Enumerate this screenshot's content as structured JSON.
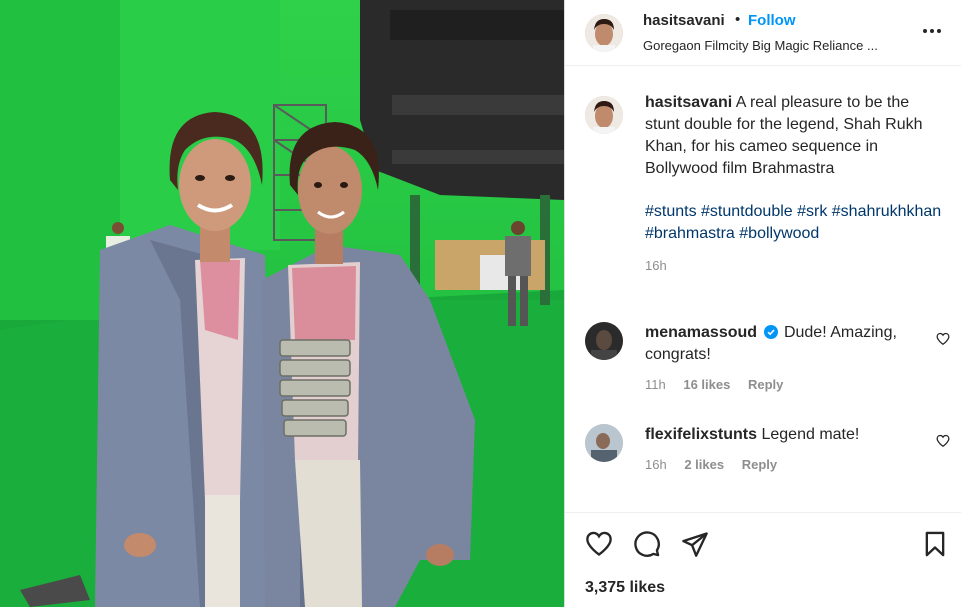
{
  "post": {
    "username": "hasitsavani",
    "dot": "•",
    "follow_label": "Follow",
    "location": "Goregaon Filmcity Big Magic Reliance ..."
  },
  "caption": {
    "username": "hasitsavani",
    "text": "A real pleasure to be the stunt double for the legend, Shah Rukh Khan, for his cameo sequence in Bollywood film Brahmastra",
    "hashtags": "#stunts #stuntdouble #srk #shahrukhkhan #brahmastra #bollywood",
    "time": "16h"
  },
  "comments": [
    {
      "username": "menamassoud",
      "verified": true,
      "text": "Dude! Amazing, congrats!",
      "time": "11h",
      "likes": "16 likes",
      "reply_label": "Reply"
    },
    {
      "username": "flexifelixstunts",
      "verified": false,
      "text": "Legend mate!",
      "time": "16h",
      "likes": "2 likes",
      "reply_label": "Reply"
    }
  ],
  "footer": {
    "likes": "3,375 likes"
  },
  "icons": {
    "more": "more-options-icon",
    "like": "heart-icon",
    "comment": "comment-bubble-icon",
    "share": "paper-plane-icon",
    "save": "bookmark-icon"
  },
  "colors": {
    "link_blue": "#0095f6",
    "hashtag_blue": "#00376b",
    "muted": "#8e8e8e",
    "greenscreen": "#24c442"
  }
}
